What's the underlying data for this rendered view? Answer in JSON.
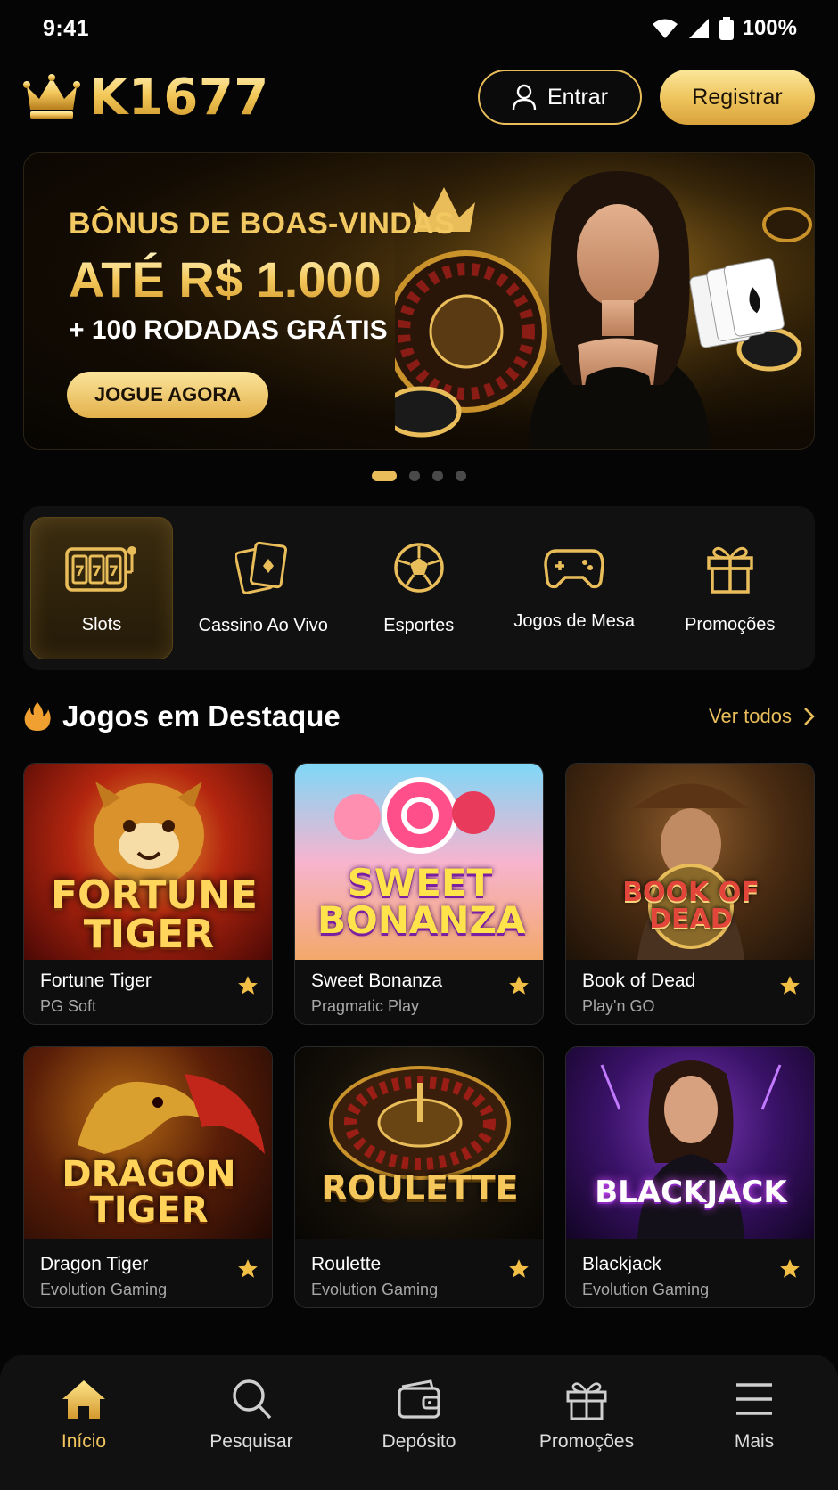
{
  "status": {
    "time": "9:41",
    "battery": "100%"
  },
  "header": {
    "brand": "K1677",
    "login_label": "Entrar",
    "register_label": "Registrar"
  },
  "banner": {
    "line1": "BÔNUS DE BOAS-VINDAS",
    "line2": "ATÉ R$ 1.000",
    "line3": "+ 100 RODADAS GRÁTIS",
    "cta": "JOGUE AGORA",
    "slides_total": 4,
    "active_slide": 1
  },
  "categories": [
    {
      "label": "Slots",
      "icon": "slot-machine-icon",
      "active": true
    },
    {
      "label": "Cassino Ao Vivo",
      "icon": "cards-icon",
      "active": false
    },
    {
      "label": "Esportes",
      "icon": "soccer-ball-icon",
      "active": false
    },
    {
      "label": "Jogos de Mesa",
      "icon": "gamepad-icon",
      "active": false
    },
    {
      "label": "Promoções",
      "icon": "gift-icon",
      "active": false
    }
  ],
  "featured": {
    "title": "Jogos em Destaque",
    "see_all": "Ver todos",
    "games": [
      {
        "name": "Fortune Tiger",
        "provider": "PG Soft",
        "thumb_title": "FORTUNE TIGER"
      },
      {
        "name": "Sweet Bonanza",
        "provider": "Pragmatic Play",
        "thumb_title": "SWEET BONANZA"
      },
      {
        "name": "Book of Dead",
        "provider": "Play'n GO",
        "thumb_title": "BOOK OF DEAD"
      },
      {
        "name": "Dragon Tiger",
        "provider": "Evolution Gaming",
        "thumb_title": "DRAGON TIGER"
      },
      {
        "name": "Roulette",
        "provider": "Evolution Gaming",
        "thumb_title": "ROULETTE"
      },
      {
        "name": "Blackjack",
        "provider": "Evolution Gaming",
        "thumb_title": "BLACKJACK"
      }
    ]
  },
  "nav": [
    {
      "label": "Início",
      "icon": "home-icon",
      "active": true
    },
    {
      "label": "Pesquisar",
      "icon": "search-icon",
      "active": false
    },
    {
      "label": "Depósito",
      "icon": "wallet-icon",
      "active": false
    },
    {
      "label": "Promoções",
      "icon": "gift-icon",
      "active": false
    },
    {
      "label": "Mais",
      "icon": "menu-icon",
      "active": false
    }
  ],
  "colors": {
    "gold": "#e8bd5a",
    "background": "#050505",
    "panel": "#111111"
  }
}
